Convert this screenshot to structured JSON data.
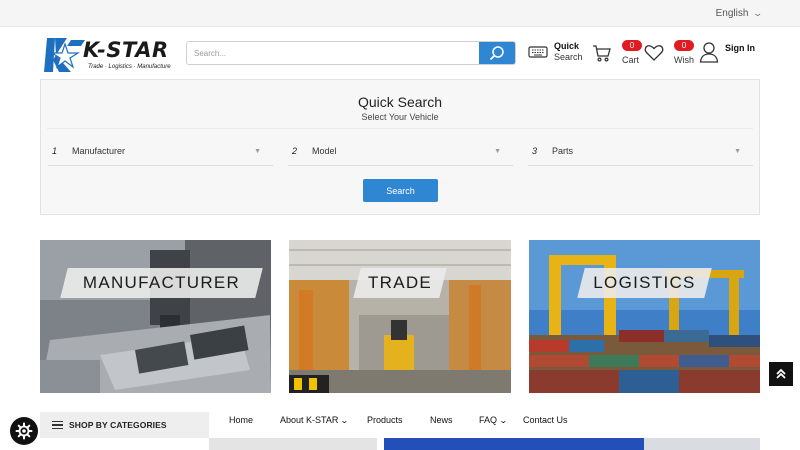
{
  "topbar": {
    "language": "English"
  },
  "logo": {
    "name": "K-STAR",
    "tagline": "Trade · Logistics · Manufacture"
  },
  "search": {
    "placeholder": "Search..."
  },
  "header": {
    "quick_search": {
      "line1": "Quick",
      "line2": "Search"
    },
    "cart": {
      "label": "Cart",
      "count": "0"
    },
    "wish": {
      "label": "Wish",
      "count": "0"
    },
    "signin": {
      "label": "Sign In"
    }
  },
  "quick_search_panel": {
    "title": "Quick Search",
    "subtitle": "Select Your Vehicle",
    "selects": [
      {
        "num": "1",
        "label": "Manufacturer"
      },
      {
        "num": "2",
        "label": "Model"
      },
      {
        "num": "3",
        "label": "Parts"
      }
    ],
    "button": "Search"
  },
  "tiles": [
    {
      "label": "MANUFACTURER"
    },
    {
      "label": "TRADE"
    },
    {
      "label": "LOGISTICS"
    }
  ],
  "categories": {
    "label": "SHOP BY CATEGORIES"
  },
  "nav": {
    "items": [
      {
        "label": "Home"
      },
      {
        "label": "About K-STAR"
      },
      {
        "label": "Products"
      },
      {
        "label": "News"
      },
      {
        "label": "FAQ"
      },
      {
        "label": "Contact Us"
      }
    ]
  },
  "colors": {
    "accent": "#2f86d3",
    "badge": "#e01b22",
    "brand": "#1f6fc0"
  },
  "icons": [
    "chevron-down-icon",
    "search-icon",
    "keyboard-icon",
    "cart-icon",
    "heart-icon",
    "user-icon",
    "arrow-up-icon",
    "gear-icon",
    "menu-icon"
  ]
}
